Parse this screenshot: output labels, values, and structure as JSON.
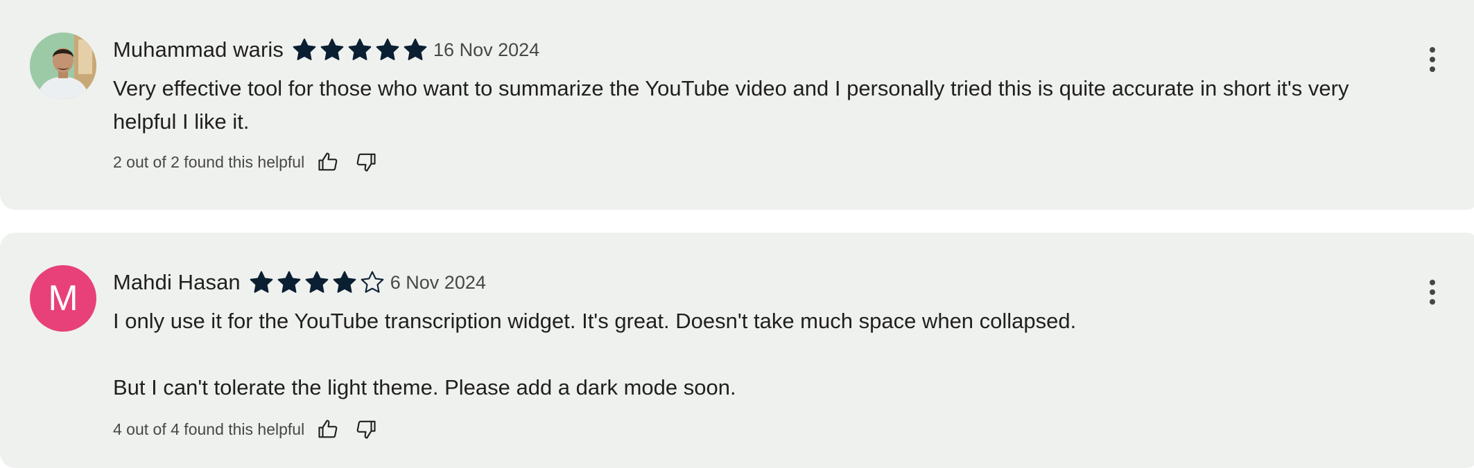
{
  "reviews": [
    {
      "author": "Muhammad waris",
      "avatar_type": "photo",
      "rating": 5,
      "date": "16 Nov 2024",
      "paragraphs": [
        "Very effective tool for those who want to summarize the YouTube video and I personally tried this is quite accurate in short it's very helpful I like it."
      ],
      "helpful_text": "2 out of 2 found this helpful",
      "icons": [
        "thumb-up-icon",
        "thumb-down-icon",
        "more-vert-icon",
        "star-icon"
      ]
    },
    {
      "author": "Mahdi Hasan",
      "avatar_type": "letter",
      "avatar_letter": "M",
      "avatar_color": "#e8417a",
      "rating": 4,
      "date": "6 Nov 2024",
      "paragraphs": [
        "I only use it for the YouTube transcription widget. It's great. Doesn't take much space when collapsed.",
        "But I can't tolerate the light theme. Please add a dark mode soon."
      ],
      "helpful_text": "4 out of 4 found this helpful",
      "icons": [
        "thumb-up-icon",
        "thumb-down-icon",
        "more-vert-icon",
        "star-icon"
      ]
    }
  ],
  "colors": {
    "card_background": "#eff1ee",
    "star_fill": "#0b1f33",
    "text_primary": "#1f1f1f",
    "text_secondary": "#474747"
  }
}
